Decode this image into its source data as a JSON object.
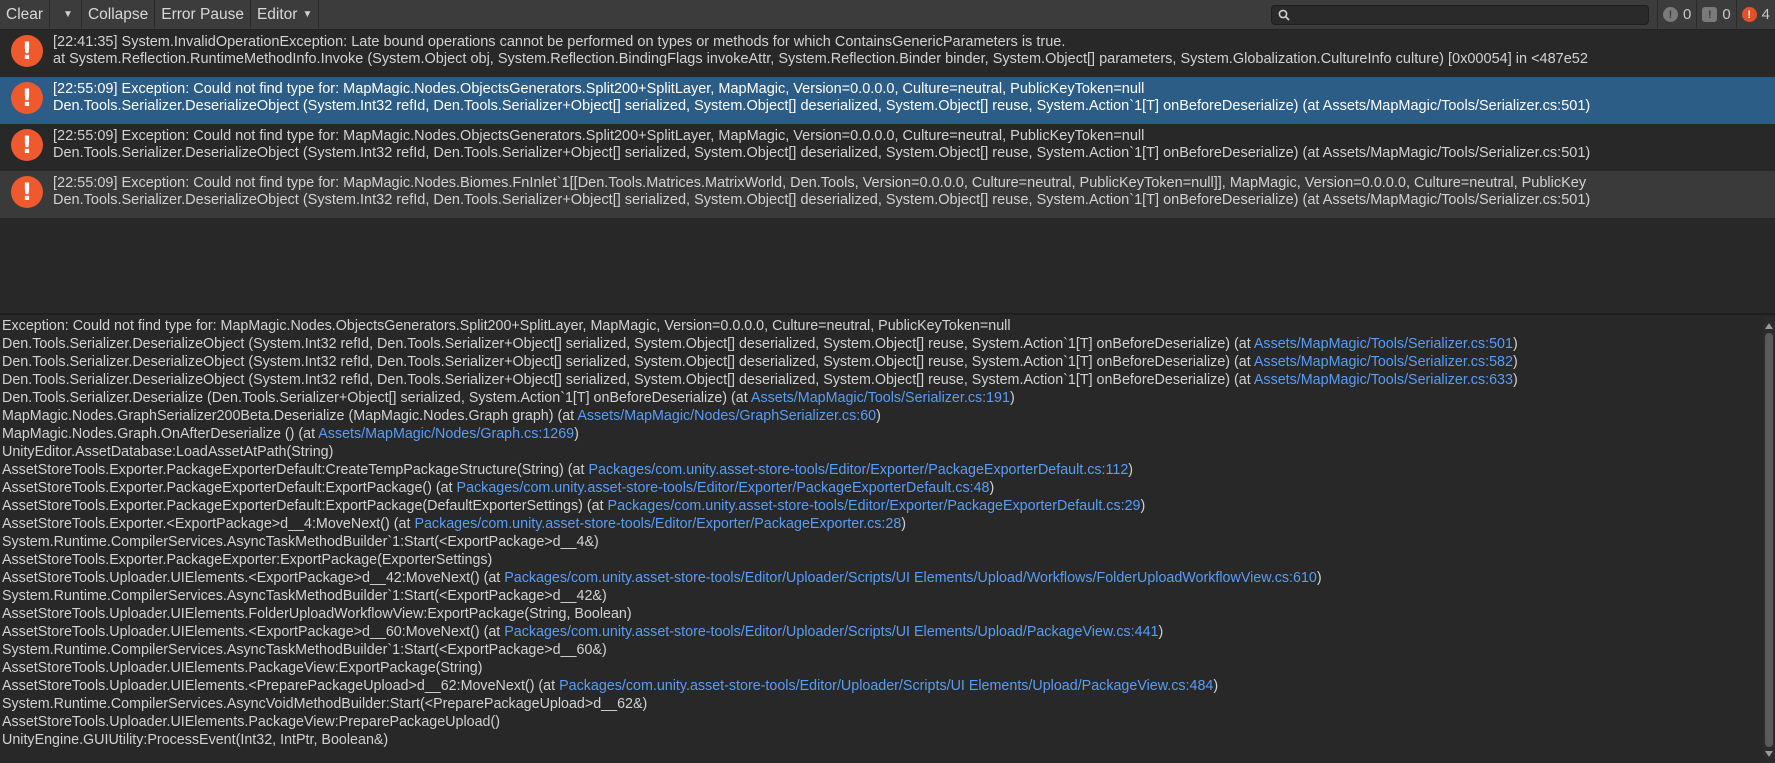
{
  "toolbar": {
    "clear": "Clear",
    "collapse": "Collapse",
    "error_pause": "Error Pause",
    "editor": "Editor",
    "search_placeholder": "",
    "info_count": "0",
    "warning_count": "0",
    "error_count": "4"
  },
  "logs": [
    {
      "line1": "[22:41:35] System.InvalidOperationException: Late bound operations cannot be performed on types or methods for which ContainsGenericParameters is true.",
      "line2": "  at System.Reflection.RuntimeMethodInfo.Invoke (System.Object obj, System.Reflection.BindingFlags invokeAttr, System.Reflection.Binder binder, System.Object[] parameters, System.Globalization.CultureInfo culture) [0x00054] in <487e52"
    },
    {
      "line1": "[22:55:09] Exception: Could not find type for: MapMagic.Nodes.ObjectsGenerators.Split200+SplitLayer, MapMagic, Version=0.0.0.0, Culture=neutral, PublicKeyToken=null",
      "line2": "Den.Tools.Serializer.DeserializeObject (System.Int32 refId, Den.Tools.Serializer+Object[] serialized, System.Object[] deserialized, System.Object[] reuse, System.Action`1[T] onBeforeDeserialize) (at Assets/MapMagic/Tools/Serializer.cs:501)"
    },
    {
      "line1": "[22:55:09] Exception: Could not find type for: MapMagic.Nodes.ObjectsGenerators.Split200+SplitLayer, MapMagic, Version=0.0.0.0, Culture=neutral, PublicKeyToken=null",
      "line2": "Den.Tools.Serializer.DeserializeObject (System.Int32 refId, Den.Tools.Serializer+Object[] serialized, System.Object[] deserialized, System.Object[] reuse, System.Action`1[T] onBeforeDeserialize) (at Assets/MapMagic/Tools/Serializer.cs:501)"
    },
    {
      "line1": "[22:55:09] Exception: Could not find type for: MapMagic.Nodes.Biomes.FnInlet`1[[Den.Tools.Matrices.MatrixWorld, Den.Tools, Version=0.0.0.0, Culture=neutral, PublicKeyToken=null]], MapMagic, Version=0.0.0.0, Culture=neutral, PublicKey",
      "line2": "Den.Tools.Serializer.DeserializeObject (System.Int32 refId, Den.Tools.Serializer+Object[] serialized, System.Object[] deserialized, System.Object[] reuse, System.Action`1[T] onBeforeDeserialize) (at Assets/MapMagic/Tools/Serializer.cs:501)"
    }
  ],
  "detail": [
    {
      "text": "Exception: Could not find type for: MapMagic.Nodes.ObjectsGenerators.Split200+SplitLayer, MapMagic, Version=0.0.0.0, Culture=neutral, PublicKeyToken=null"
    },
    {
      "text": "Den.Tools.Serializer.DeserializeObject (System.Int32 refId, Den.Tools.Serializer+Object[] serialized, System.Object[] deserialized, System.Object[] reuse, System.Action`1[T] onBeforeDeserialize) (at ",
      "link": "Assets/MapMagic/Tools/Serializer.cs:501",
      "tail": ")"
    },
    {
      "text": "Den.Tools.Serializer.DeserializeObject (System.Int32 refId, Den.Tools.Serializer+Object[] serialized, System.Object[] deserialized, System.Object[] reuse, System.Action`1[T] onBeforeDeserialize) (at ",
      "link": "Assets/MapMagic/Tools/Serializer.cs:582",
      "tail": ")"
    },
    {
      "text": "Den.Tools.Serializer.DeserializeObject (System.Int32 refId, Den.Tools.Serializer+Object[] serialized, System.Object[] deserialized, System.Object[] reuse, System.Action`1[T] onBeforeDeserialize) (at ",
      "link": "Assets/MapMagic/Tools/Serializer.cs:633",
      "tail": ")"
    },
    {
      "text": "Den.Tools.Serializer.Deserialize (Den.Tools.Serializer+Object[] serialized, System.Action`1[T] onBeforeDeserialize) (at ",
      "link": "Assets/MapMagic/Tools/Serializer.cs:191",
      "tail": ")"
    },
    {
      "text": "MapMagic.Nodes.GraphSerializer200Beta.Deserialize (MapMagic.Nodes.Graph graph) (at ",
      "link": "Assets/MapMagic/Nodes/GraphSerializer.cs:60",
      "tail": ")"
    },
    {
      "text": "MapMagic.Nodes.Graph.OnAfterDeserialize () (at ",
      "link": "Assets/MapMagic/Nodes/Graph.cs:1269",
      "tail": ")"
    },
    {
      "text": "UnityEditor.AssetDatabase:LoadAssetAtPath(String)"
    },
    {
      "text": "AssetStoreTools.Exporter.PackageExporterDefault:CreateTempPackageStructure(String) (at ",
      "link": "Packages/com.unity.asset-store-tools/Editor/Exporter/PackageExporterDefault.cs:112",
      "tail": ")"
    },
    {
      "text": "AssetStoreTools.Exporter.PackageExporterDefault:ExportPackage() (at ",
      "link": "Packages/com.unity.asset-store-tools/Editor/Exporter/PackageExporterDefault.cs:48",
      "tail": ")"
    },
    {
      "text": "AssetStoreTools.Exporter.PackageExporterDefault:ExportPackage(DefaultExporterSettings) (at ",
      "link": "Packages/com.unity.asset-store-tools/Editor/Exporter/PackageExporterDefault.cs:29",
      "tail": ")"
    },
    {
      "text": "AssetStoreTools.Exporter.<ExportPackage>d__4:MoveNext() (at ",
      "link": "Packages/com.unity.asset-store-tools/Editor/Exporter/PackageExporter.cs:28",
      "tail": ")"
    },
    {
      "text": "System.Runtime.CompilerServices.AsyncTaskMethodBuilder`1:Start(<ExportPackage>d__4&)"
    },
    {
      "text": "AssetStoreTools.Exporter.PackageExporter:ExportPackage(ExporterSettings)"
    },
    {
      "text": "AssetStoreTools.Uploader.UIElements.<ExportPackage>d__42:MoveNext() (at ",
      "link": "Packages/com.unity.asset-store-tools/Editor/Uploader/Scripts/UI Elements/Upload/Workflows/FolderUploadWorkflowView.cs:610",
      "tail": ")"
    },
    {
      "text": "System.Runtime.CompilerServices.AsyncTaskMethodBuilder`1:Start(<ExportPackage>d__42&)"
    },
    {
      "text": "AssetStoreTools.Uploader.UIElements.FolderUploadWorkflowView:ExportPackage(String, Boolean)"
    },
    {
      "text": "AssetStoreTools.Uploader.UIElements.<ExportPackage>d__60:MoveNext() (at ",
      "link": "Packages/com.unity.asset-store-tools/Editor/Uploader/Scripts/UI Elements/Upload/PackageView.cs:441",
      "tail": ")"
    },
    {
      "text": "System.Runtime.CompilerServices.AsyncTaskMethodBuilder`1:Start(<ExportPackage>d__60&)"
    },
    {
      "text": "AssetStoreTools.Uploader.UIElements.PackageView:ExportPackage(String)"
    },
    {
      "text": "AssetStoreTools.Uploader.UIElements.<PreparePackageUpload>d__62:MoveNext() (at ",
      "link": "Packages/com.unity.asset-store-tools/Editor/Uploader/Scripts/UI Elements/Upload/PackageView.cs:484",
      "tail": ")"
    },
    {
      "text": "System.Runtime.CompilerServices.AsyncVoidMethodBuilder:Start(<PreparePackageUpload>d__62&)"
    },
    {
      "text": "AssetStoreTools.Uploader.UIElements.PackageView:PreparePackageUpload()"
    },
    {
      "text": "UnityEngine.GUIUtility:ProcessEvent(Int32, IntPtr, Boolean&)"
    }
  ],
  "colors": {
    "background": "#282828",
    "toolbar": "#3c3c3c",
    "selected_row": "#2c5d87",
    "error_icon": "#ee5a2d",
    "link": "#589df6"
  },
  "icons": {
    "error": "error-icon",
    "search": "search-icon",
    "info": "info-icon",
    "warning": "warning-icon"
  }
}
